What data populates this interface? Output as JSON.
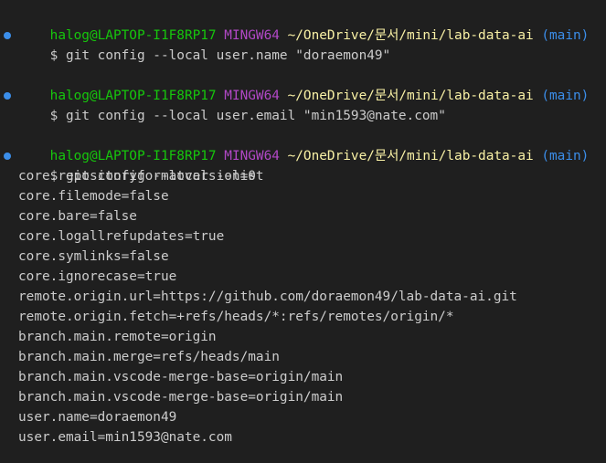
{
  "prompt": {
    "user_host": "halog@LAPTOP-I1F8RP17",
    "shell": "MINGW64",
    "path": "~/OneDrive/문서/mini/lab-data-ai",
    "branch": "(main)",
    "dollar": "$"
  },
  "commands": [
    {
      "text": "git config --local user.name \"doraemon49\""
    },
    {
      "text": "git config --local user.email \"min1593@nate.com\""
    },
    {
      "text": "git config --local --list"
    }
  ],
  "output_lines": [
    "core.repositoryformatversion=0",
    "core.filemode=false",
    "core.bare=false",
    "core.logallrefupdates=true",
    "core.symlinks=false",
    "core.ignorecase=true",
    "remote.origin.url=https://github.com/doraemon49/lab-data-ai.git",
    "remote.origin.fetch=+refs/heads/*:refs/remotes/origin/*",
    "branch.main.remote=origin",
    "branch.main.merge=refs/heads/main",
    "branch.main.vscode-merge-base=origin/main",
    "branch.main.vscode-merge-base=origin/main",
    "user.name=doraemon49",
    "user.email=min1593@nate.com"
  ],
  "colors": {
    "background": "#1f1f1f",
    "user_host": "#16c60c",
    "shell": "#b148c6",
    "path": "#f9f1a5",
    "branch": "#3b8eea",
    "text": "#cccccc",
    "marker": "#3b8eea"
  }
}
